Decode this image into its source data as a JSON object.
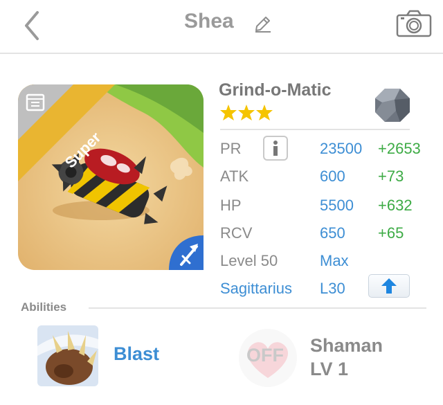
{
  "header": {
    "title": "Shea"
  },
  "monster": {
    "name": "Grind-o-Matic",
    "badge": "Super",
    "stars": 3,
    "stats": [
      {
        "label": "PR",
        "value": "23500",
        "bonus": "+2653"
      },
      {
        "label": "ATK",
        "value": "600",
        "bonus": "+73"
      },
      {
        "label": "HP",
        "value": "5500",
        "bonus": "+632"
      },
      {
        "label": "RCV",
        "value": "650",
        "bonus": "+65"
      }
    ],
    "level": {
      "label": "Level 50",
      "value": "Max"
    },
    "zodiac": {
      "label": "Sagittarius",
      "value": "L30"
    }
  },
  "abilities": {
    "heading": "Abilities",
    "skill_name": "Blast",
    "off_label": "OFF",
    "class_name": "Shaman",
    "class_level": "LV 1"
  },
  "icons": {
    "back": "chevron-left-icon",
    "edit": "pencil-icon",
    "camera": "camera-icon",
    "info": "info-icon",
    "upgrade": "arrow-up-icon",
    "element": "stone-element-icon",
    "class": "sagittarius-arrow-icon"
  },
  "colors": {
    "accent_blue": "#3d8ed4",
    "bonus_green": "#3dab45",
    "star_yellow": "#f5c400",
    "super_banner": "#e9b531"
  }
}
